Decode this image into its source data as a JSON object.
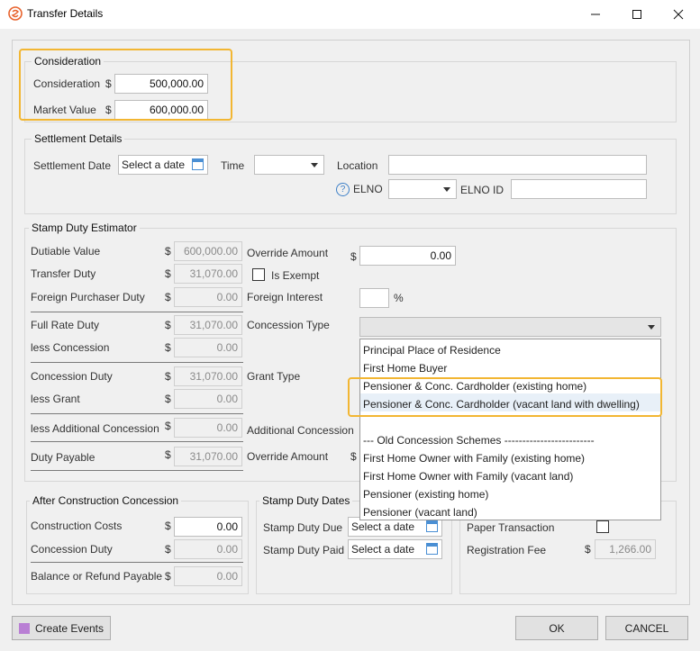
{
  "window": {
    "title": "Transfer Details"
  },
  "consideration": {
    "title": "Consideration",
    "consideration_label": "Consideration",
    "consideration_value": "500,000.00",
    "market_label": "Market Value",
    "market_value": "600,000.00",
    "currency": "$"
  },
  "settlement": {
    "title": "Settlement Details",
    "date_label": "Settlement Date",
    "date_placeholder": "Select a date",
    "time_label": "Time",
    "location_label": "Location",
    "elno_label": "ELNO",
    "elno_id_label": "ELNO ID"
  },
  "estimator": {
    "title": "Stamp Duty Estimator",
    "dutiable_label": "Dutiable Value",
    "dutiable_value": "600,000.00",
    "transfer_label": "Transfer Duty",
    "transfer_value": "31,070.00",
    "foreign_label": "Foreign Purchaser Duty",
    "foreign_value": "0.00",
    "full_rate_label": "Full Rate Duty",
    "full_rate_value": "31,070.00",
    "less_concession_label": "less Concession",
    "less_concession_value": "0.00",
    "concession_duty_label": "Concession Duty",
    "concession_duty_value": "31,070.00",
    "less_grant_label": "less Grant",
    "less_grant_value": "0.00",
    "less_add_label": "less Additional Concession",
    "less_add_value": "0.00",
    "duty_payable_label": "Duty Payable",
    "duty_payable_value": "31,070.00",
    "override_label": "Override Amount",
    "override_value": "0.00",
    "exempt_label": "Is Exempt",
    "foreign_interest_label": "Foreign Interest",
    "percent": "%",
    "concession_type_label": "Concession Type",
    "grant_type_label": "Grant Type",
    "additional_concession_label": "Additional Concession",
    "override2_label": "Override Amount"
  },
  "concession_options": [
    "Principal Place of Residence",
    "First Home Buyer",
    "Pensioner & Conc. Cardholder (existing home)",
    "Pensioner & Conc. Cardholder (vacant land with dwelling)",
    "--- Old Concession Schemes -------------------------",
    "First Home Owner with Family (existing home)",
    "First Home Owner with Family (vacant land)",
    "Pensioner (existing home)",
    "Pensioner (vacant land)"
  ],
  "after_construction": {
    "title": "After Construction Concession",
    "costs_label": "Construction Costs",
    "costs_value": "0.00",
    "duty_label": "Concession Duty",
    "duty_value": "0.00",
    "balance_label": "Balance or Refund Payable",
    "balance_value": "0.00"
  },
  "stamp_dates": {
    "title": "Stamp Duty Dates",
    "due_label": "Stamp Duty Due",
    "paid_label": "Stamp Duty Paid",
    "placeholder": "Select a date"
  },
  "other": {
    "paper_label": "Paper Transaction",
    "reg_fee_label": "Registration Fee",
    "reg_fee_value": "1,266.00"
  },
  "buttons": {
    "create_events": "Create Events",
    "ok": "OK",
    "cancel": "CANCEL"
  },
  "colors": {
    "highlight": "#f2b632",
    "accent": "#3c7fc7",
    "logo": "#e8622c"
  }
}
